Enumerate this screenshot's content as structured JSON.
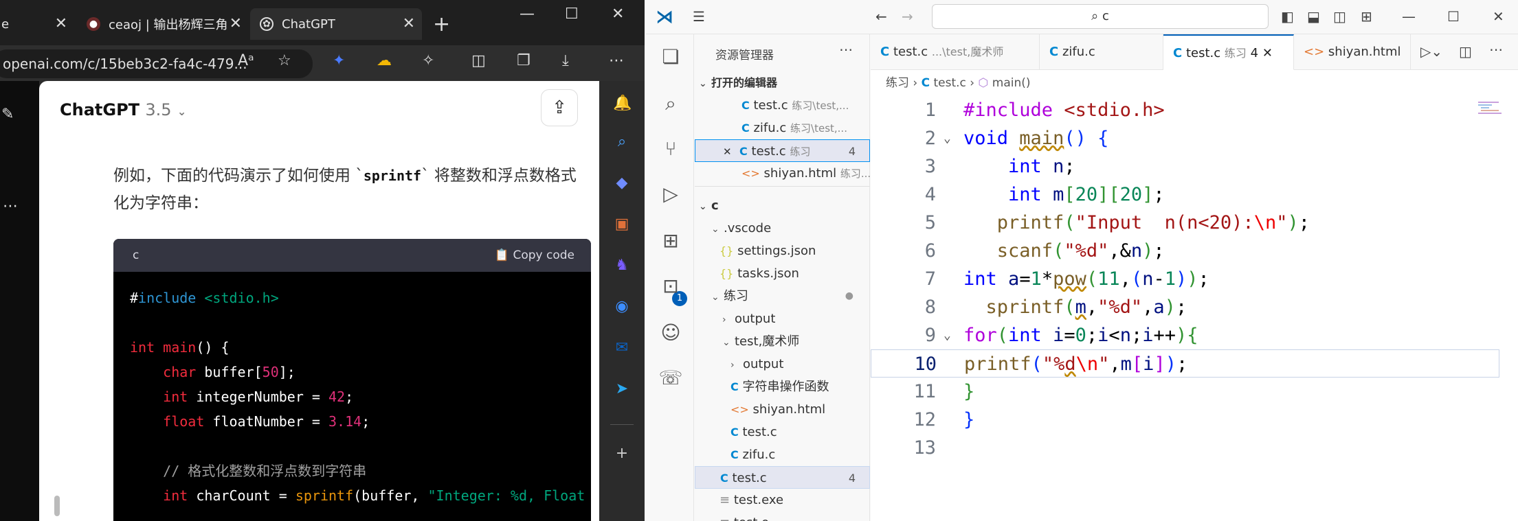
{
  "browser": {
    "tabs": [
      {
        "title": "e"
      },
      {
        "title": "ceaoj | 输出杨辉三角"
      },
      {
        "title": "ChatGPT"
      }
    ],
    "url": "openai.com/c/15beb3c2-fa4c-479...",
    "chat": {
      "title": "ChatGPT",
      "version": "3.5",
      "para_before": "例如，下面的代码演示了如何使用 `",
      "para_code": "sprintf",
      "para_after": "` 将整数和浮点数格式化为字符串：",
      "code_lang": "c",
      "copy_label": "Copy code"
    }
  },
  "vscode": {
    "search_text": "c",
    "explorer_title": "资源管理器",
    "open_editors_label": "打开的编辑器",
    "open_editors": [
      {
        "name": "test.c",
        "desc": "练习\\test,..."
      },
      {
        "name": "zifu.c",
        "desc": "练习\\test,..."
      },
      {
        "name": "test.c",
        "desc": "练习",
        "count": "4"
      },
      {
        "name": "shiyan.html",
        "desc": "练习..."
      }
    ],
    "folder_label": "c",
    "tree": [
      {
        "name": ".vscode"
      },
      {
        "name": "settings.json"
      },
      {
        "name": "tasks.json"
      },
      {
        "name": "练习"
      },
      {
        "name": "output"
      },
      {
        "name": "test,魔术师"
      },
      {
        "name": "output"
      },
      {
        "name": "字符串操作函数"
      },
      {
        "name": "shiyan.html"
      },
      {
        "name": "test.c"
      },
      {
        "name": "zifu.c"
      },
      {
        "name": "test.c",
        "count": "4"
      },
      {
        "name": "test.exe"
      },
      {
        "name": "test.o"
      }
    ],
    "tabs": [
      {
        "name": "test.c",
        "desc": "...\\test,魔术师"
      },
      {
        "name": "zifu.c",
        "desc": ""
      },
      {
        "name": "test.c",
        "desc": "练习",
        "count": "4"
      },
      {
        "name": "shiyan.html",
        "desc": ""
      }
    ],
    "breadcrumb": {
      "folder": "练习",
      "file": "test.c",
      "symbol": "main()"
    },
    "line_numbers": [
      "1",
      "2",
      "3",
      "4",
      "5",
      "6",
      "7",
      "8",
      "9",
      "10",
      "11",
      "12",
      "13"
    ],
    "activity_badge": "1"
  }
}
